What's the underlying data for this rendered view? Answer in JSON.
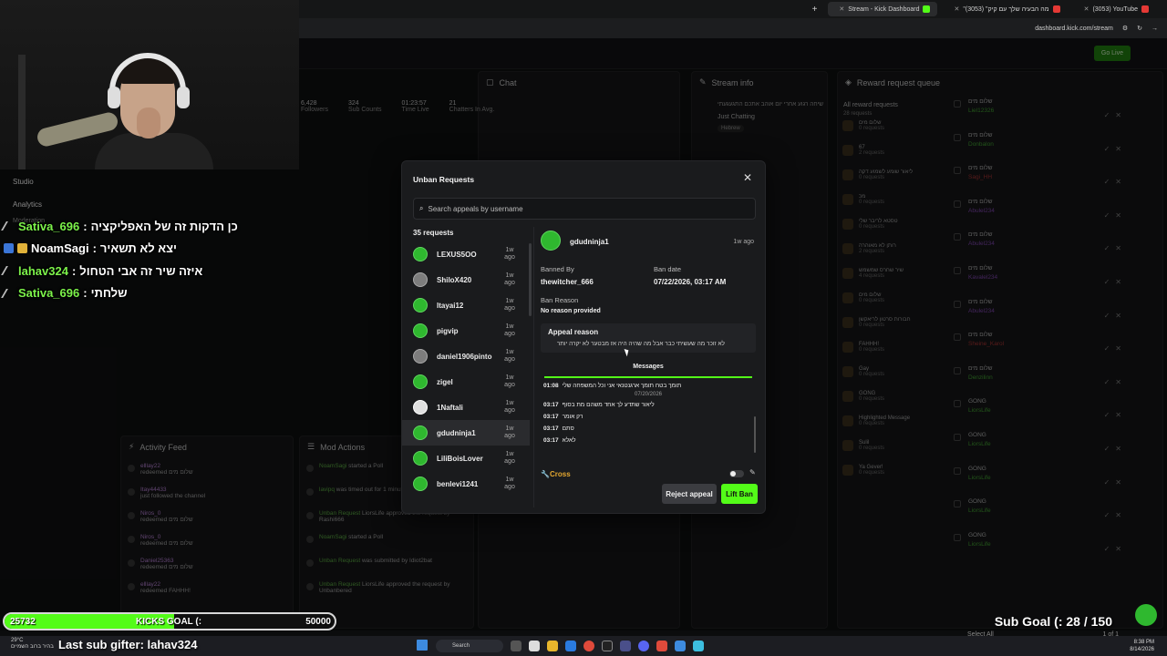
{
  "browser": {
    "tabs": [
      {
        "title": "Stream - Kick Dashboard",
        "active": true,
        "favicon": "kick-icon"
      },
      {
        "title": "\"מה הבעיה שלך עם קיק\" (3053)",
        "active": false,
        "favicon": "youtube-icon"
      },
      {
        "title": "(3053) YouTube",
        "active": false,
        "favicon": "youtube-icon"
      }
    ],
    "url": "dashboard.kick.com/stream"
  },
  "dashboard": {
    "go_live": "Go Live",
    "chat_title": "Chat",
    "stream_info_title": "Stream info",
    "reward_queue_title": "Reward request queue",
    "all_reward_requests": "All reward requests",
    "reward_requests_count": "28 requests",
    "stream_title_text": "שיחה רגוע אחרי יום אוהב אתכם התגעגעתי",
    "category": "Just Chatting",
    "language": "Hebrew",
    "stats": [
      {
        "value": "6,428",
        "label": "Followers"
      },
      {
        "value": "324",
        "label": "Sub Counts"
      },
      {
        "value": "01:23:57",
        "label": "Time Live"
      },
      {
        "value": "21",
        "label": "Chatters In Avg."
      }
    ],
    "activity_feed_title": "Activity Feed",
    "mod_actions_title": "Mod Actions",
    "studio": "Studio",
    "analytics": "Analytics",
    "moderation": "Moderation",
    "reward_items": [
      {
        "name": "שלום מים",
        "sub": "0 requests"
      },
      {
        "name": "67",
        "sub": "2 requests"
      },
      {
        "name": "ליאור שומע לשמוע דקה",
        "sub": "0 requests"
      },
      {
        "name": "מכ",
        "sub": "0 requests"
      },
      {
        "name": "טסטא לריבר שלי",
        "sub": "0 requests"
      },
      {
        "name": "רותן לא מאוהרה",
        "sub": "2 requests"
      },
      {
        "name": "שיר שחרס שמשמש",
        "sub": "4 requests"
      },
      {
        "name": "שלום מים",
        "sub": "0 requests"
      },
      {
        "name": "חבורות סרטון לריאקשן",
        "sub": "0 requests"
      },
      {
        "name": "FAHHH!",
        "sub": "0 requests"
      },
      {
        "name": "Gay",
        "sub": "0 requests"
      },
      {
        "name": "GONG",
        "sub": "0 requests"
      },
      {
        "name": "Highlighted Message",
        "sub": "0 requests"
      },
      {
        "name": "Sulil",
        "sub": "0 requests"
      },
      {
        "name": "Ya Gever!",
        "sub": "0 requests"
      }
    ],
    "reward_users": [
      {
        "reward": "שלום מים",
        "user": "Liel12326",
        "ago": "5 days ago"
      },
      {
        "reward": "שלום מים",
        "user": "Donbalon",
        "ago": "5 days ago"
      },
      {
        "reward": "שלום מים",
        "user": "Sagi_HH",
        "ago": "5 days ago"
      },
      {
        "reward": "שלום מים",
        "user": "Abulel234",
        "ago": "5 days ago"
      },
      {
        "reward": "שלום מים",
        "user": "Abulel234",
        "ago": "5 days ago"
      },
      {
        "reward": "שלום מים",
        "user": "Kavalel234",
        "ago": "5 days ago"
      },
      {
        "reward": "שלום מים",
        "user": "Abulel234",
        "ago": "5 days ago"
      },
      {
        "reward": "שלום מים",
        "user": "Sheine_Karol",
        "ago": "5 days ago"
      },
      {
        "reward": "שלום מים",
        "user": "Denzilinn",
        "ago": "5 days ago"
      },
      {
        "reward": "GONG",
        "user": "LiorsLife",
        "ago": "5 hours ago"
      },
      {
        "reward": "GONG",
        "user": "LiorsLife",
        "ago": "5 hours ago"
      },
      {
        "reward": "GONG",
        "user": "LiorsLife",
        "ago": "5 hours ago"
      },
      {
        "reward": "GONG",
        "user": "LiorsLife",
        "ago": "5 hours ago"
      },
      {
        "reward": "GONG",
        "user": "LiorsLife",
        "ago": "5 hours ago"
      }
    ],
    "select_all": "Select All",
    "pager": "1 of 1",
    "feed": [
      {
        "user": "elllay22",
        "text": "redeemed שלום מים"
      },
      {
        "user": "Itay44433",
        "text": "just followed the channel"
      },
      {
        "user": "Niros_0",
        "text": "redeemed שלום מים"
      },
      {
        "user": "Niros_0",
        "text": "redeemed שלום מים"
      },
      {
        "user": "Daniel25363",
        "text": "redeemed שלום מים"
      },
      {
        "user": "elllay22",
        "text": "redeemed FAHHH!"
      }
    ],
    "mod": [
      {
        "user": "NoamSagi",
        "text": "started a Poll"
      },
      {
        "user": "lavipq",
        "text": "was timed out for 1 minute by NoamSagi"
      },
      {
        "user": "Unban Request",
        "text": "LiorsLife approved the request by Rashi666"
      },
      {
        "user": "NoamSagi",
        "text": "started a Poll"
      },
      {
        "user": "Unban Request",
        "text": "was submitted by Idiot2bat"
      },
      {
        "user": "Unban Request",
        "text": "LiorsLife approved the request by Unbanbered"
      }
    ]
  },
  "overlay_chat": [
    {
      "user": "Sativa_696",
      "text": "כן הדקות זה של האפליקציה",
      "color": "green",
      "badge": "slash"
    },
    {
      "user": "NoamSagi",
      "text": "יצא לא תשאיר",
      "color": "white",
      "badge": "squares"
    },
    {
      "user": "lahav324",
      "text": "איזה שיר זה אבי הטחול",
      "color": "green",
      "badge": "slash"
    },
    {
      "user": "Sativa_696",
      "text": "שלחתי",
      "color": "green",
      "badge": "slash"
    }
  ],
  "modal": {
    "title": "Unban Requests",
    "search_placeholder": "Search appeals by username",
    "count_label": "35 requests",
    "requests": [
      {
        "name": "LEXUS5OO",
        "time": "1w ago",
        "avatar": "green"
      },
      {
        "name": "ShiloX420",
        "time": "1w ago",
        "avatar": "gray"
      },
      {
        "name": "Itayai12",
        "time": "1w ago",
        "avatar": "green"
      },
      {
        "name": "pigvip",
        "time": "1w ago",
        "avatar": "green"
      },
      {
        "name": "daniel1906pinto",
        "time": "1w ago",
        "avatar": "gray"
      },
      {
        "name": "zigel",
        "time": "1w ago",
        "avatar": "green"
      },
      {
        "name": "1Naftali",
        "time": "1w ago",
        "avatar": "dark"
      },
      {
        "name": "gdudninja1",
        "time": "1w ago",
        "avatar": "green",
        "selected": true
      },
      {
        "name": "LiliBoisLover",
        "time": "1w ago",
        "avatar": "green"
      },
      {
        "name": "benlevi1241",
        "time": "1w ago",
        "avatar": "green"
      }
    ],
    "detail": {
      "username": "gdudninja1",
      "time": "1w ago",
      "banned_by_label": "Banned By",
      "banned_by": "thewitcher_666",
      "ban_date_label": "Ban date",
      "ban_date": "07/22/2026, 03:17 AM",
      "ban_reason_label": "Ban Reason",
      "ban_reason": "No reason provided",
      "appeal_label": "Appeal reason",
      "appeal_text": "לא זוכר מה שעשיתי כבר אבל מה שהיה היה אז מבטער לא יקרה יותר",
      "messages_tab": "Messages",
      "messages": [
        {
          "time": "01:08",
          "text": "תומך בטח תומך ארגנטנאי אני וכל המשפחה שלי"
        },
        {
          "date": "07/20/2026"
        },
        {
          "time": "03:17",
          "text": "ליאור שתדע לך אחד משהם מת בסוף"
        },
        {
          "time": "03:17",
          "text": "רק אומר"
        },
        {
          "time": "03:17",
          "text": "סתם"
        },
        {
          "time": "03:17",
          "text": "לאלא"
        }
      ],
      "cross_label": "Cross",
      "reject_label": "Reject appeal",
      "lift_label": "Lift Ban"
    }
  },
  "goals": {
    "kicks_current": "25732",
    "kicks_label": "KICKS GOAL (:",
    "kicks_target": "50000",
    "kicks_progress": 0.5146,
    "sub_goal": "Sub Goal (: 28 / 150",
    "last_sub": "Last sub gifter: lahav324"
  },
  "taskbar": {
    "weather_temp": "29°C",
    "weather_desc": "בהיר ברוב השמיים",
    "search": "Search",
    "time": "8:38 PM",
    "date": "8/14/2026"
  },
  "colors": {
    "kick_green": "#53fc18",
    "bg": "#0e0f10",
    "modal_bg": "#1a1b1d"
  }
}
